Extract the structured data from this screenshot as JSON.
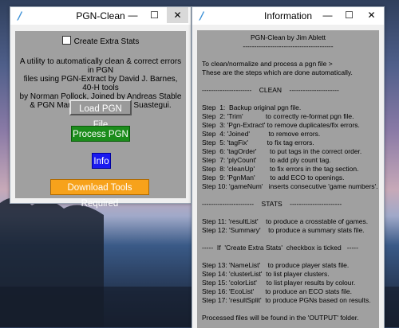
{
  "window1": {
    "title": "PGN-Clean",
    "checkbox_label": "Create Extra Stats",
    "description": [
      "A utility to automatically clean & correct errors in PGN",
      "files using PGN-Extract by David J. Barnes, 40-H tools",
      "by Norman Pollock, Joined by Andreas Stable",
      "& PGN Manager by Eduardo Suastegui."
    ],
    "load_button": "Load PGN File",
    "process_button": "Process PGN",
    "info_button": "Info",
    "download_button": "Download Tools Required"
  },
  "window2": {
    "title": "Information",
    "lines": [
      {
        "t": "PGN-Clean by Jim Ablett",
        "c": true
      },
      {
        "t": "----------------------------------------",
        "c": true
      },
      {
        "t": "",
        "c": false
      },
      {
        "t": "To clean/normalize and process a pgn file >",
        "c": false
      },
      {
        "t": "These are the steps which are done automatically.",
        "c": false
      },
      {
        "t": "",
        "c": false
      },
      {
        "t": "----------------------    CLEAN    ----------------------",
        "c": false
      },
      {
        "t": "",
        "c": false
      },
      {
        "t": "Step  1:  Backup original pgn file.",
        "c": false
      },
      {
        "t": "Step  2: 'Trim'            to correctly re-format pgn file.",
        "c": false
      },
      {
        "t": "Step  3: 'Pgn-Extract' to remove duplicates/fix errors.",
        "c": false
      },
      {
        "t": "Step  4: 'Joined'          to remove errors.",
        "c": false
      },
      {
        "t": "Step  5: 'tagFix'          to fix tag errors.",
        "c": false
      },
      {
        "t": "Step  6: 'tagOrder'       to put tags in the correct order.",
        "c": false
      },
      {
        "t": "Step  7: 'plyCount'       to add ply count tag.",
        "c": false
      },
      {
        "t": "Step  8: 'cleanUp'        to fix errors in the tag section.",
        "c": false
      },
      {
        "t": "Step  9: 'PgnMan'        to add ECO to openings.",
        "c": false
      },
      {
        "t": "Step 10: 'gameNum'   inserts consecutive 'game numbers'.",
        "c": false
      },
      {
        "t": "",
        "c": false
      },
      {
        "t": "-----------------------    STATS    -----------------------",
        "c": false
      },
      {
        "t": "",
        "c": false
      },
      {
        "t": "Step 11: 'resultList'    to produce a crosstable of games.",
        "c": false
      },
      {
        "t": "Step 12: 'Summary'    to produce a summary stats file.",
        "c": false
      },
      {
        "t": "",
        "c": false
      },
      {
        "t": "-----  If  'Create Extra Stats'  checkbox is ticked   -----",
        "c": false
      },
      {
        "t": "",
        "c": false
      },
      {
        "t": "Step 13: 'NameList'    to produce player stats file.",
        "c": false
      },
      {
        "t": "Step 14: 'clusterList'  to list player clusters.",
        "c": false
      },
      {
        "t": "Step 15: 'colorList'     to list player results by colour.",
        "c": false
      },
      {
        "t": "Step 16: 'EcoList'      to produce an ECO stats file.",
        "c": false
      },
      {
        "t": "Step 17: 'resultSplit'  to produce PGNs based on results.",
        "c": false
      },
      {
        "t": "",
        "c": false
      },
      {
        "t": "Processed files will be found in the 'OUTPUT' folder.",
        "c": false
      }
    ]
  },
  "titlebar_buttons": {
    "minimize": "—",
    "maximize": "☐",
    "close": "✕"
  },
  "colors": {
    "process": "#1b8c1b",
    "info": "#1a1af0",
    "download": "#f7a21b",
    "panel": "#a0a0a0"
  }
}
